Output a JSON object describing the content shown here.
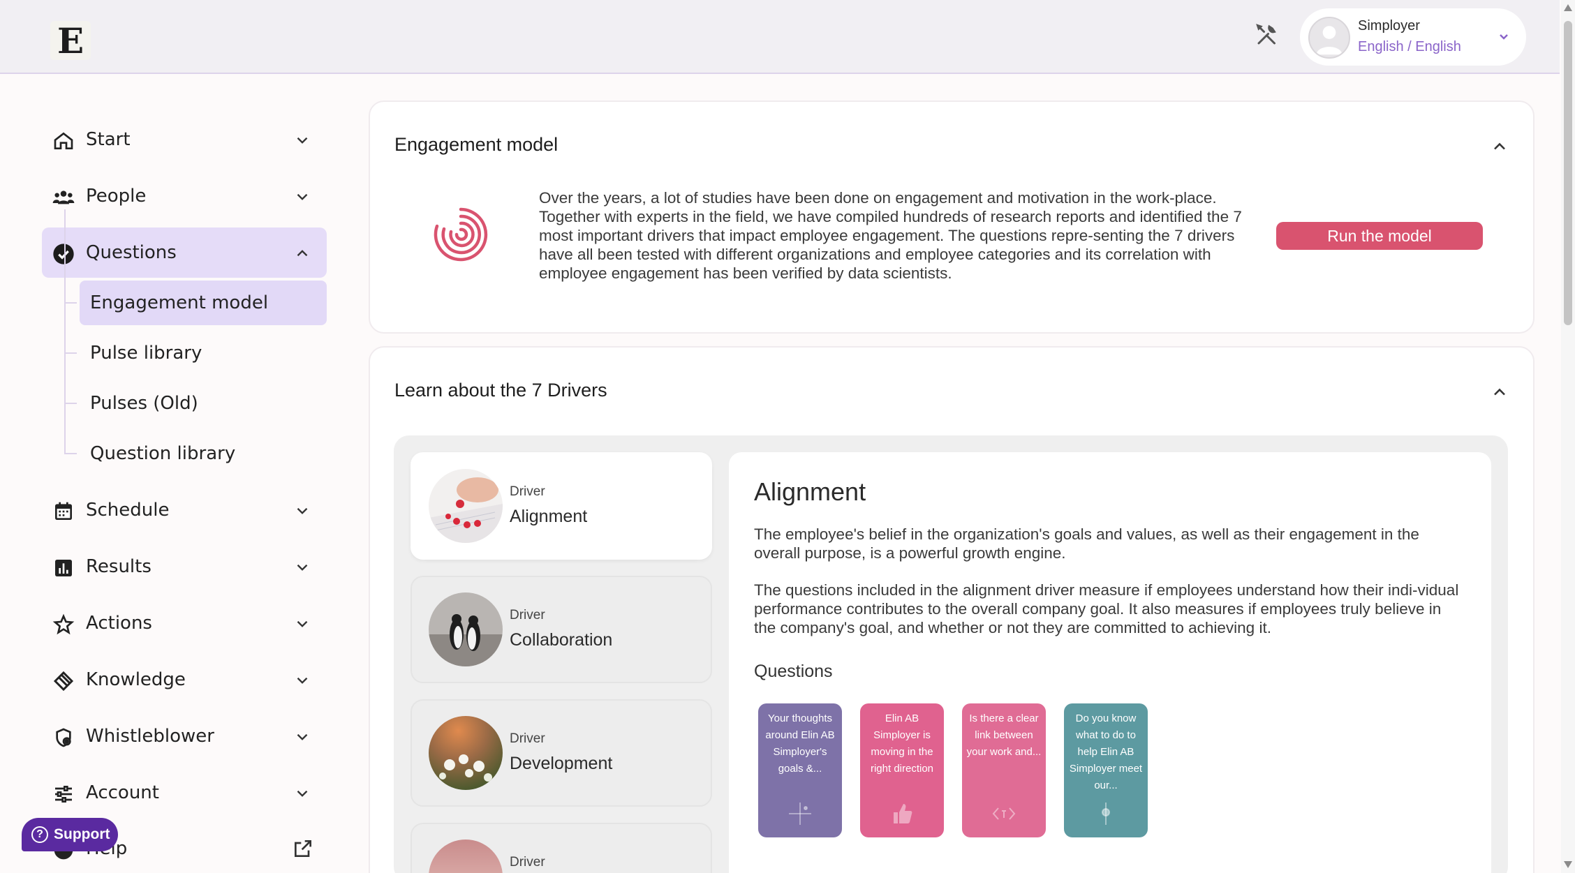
{
  "header": {
    "logo_letter": "E",
    "user_name": "Simployer",
    "user_language": "English / English"
  },
  "sidebar": {
    "items": [
      {
        "label": "Start",
        "icon": "home-icon"
      },
      {
        "label": "People",
        "icon": "people-icon"
      },
      {
        "label": "Questions",
        "icon": "check-circle-icon",
        "active": true
      },
      {
        "label": "Schedule",
        "icon": "calendar-icon"
      },
      {
        "label": "Results",
        "icon": "bar-chart-icon"
      },
      {
        "label": "Actions",
        "icon": "star-icon"
      },
      {
        "label": "Knowledge",
        "icon": "layers-icon"
      },
      {
        "label": "Whistleblower",
        "icon": "shield-icon"
      },
      {
        "label": "Account",
        "icon": "sliders-icon"
      },
      {
        "label": "Help",
        "icon": "help-icon"
      }
    ],
    "sub_items": [
      {
        "label": "Engagement model",
        "active": true
      },
      {
        "label": "Pulse library"
      },
      {
        "label": "Pulses (Old)"
      },
      {
        "label": "Question library"
      }
    ],
    "support_label": "Support"
  },
  "engagement": {
    "title": "Engagement model",
    "text": "Over the years, a lot of studies have been done on engagement and motivation in the work-place. Together with experts in the field, we have compiled hundreds of research reports and identified the 7 most important drivers that impact employee engagement. The questions repre-senting the 7 drivers have all been tested with different organizations and employee categories and its correlation with employee engagement has been verified by data scientists.",
    "button_label": "Run the model"
  },
  "drivers": {
    "title": "Learn about the 7 Drivers",
    "caption": "Driver",
    "list": [
      {
        "name": "Alignment",
        "active": true
      },
      {
        "name": "Collaboration"
      },
      {
        "name": "Development"
      },
      {
        "name": ""
      }
    ],
    "detail": {
      "title": "Alignment",
      "p1": "The employee's belief in the organization's goals and values, as well as their engagement in the overall purpose, is a powerful growth engine.",
      "p2": "The questions included in the alignment driver measure if employees understand how their indi-vidual performance contributes to the overall company goal. It also measures if employees truly believe in the company's goal, and whether or not they are committed to achieving it.",
      "questions_label": "Questions",
      "question_cards": [
        {
          "text": "Your thoughts around Elin AB Simployer's goals &...",
          "color": "#7e72a8"
        },
        {
          "text": "Elin AB Simployer is moving in the right direction",
          "color": "#e0628f"
        },
        {
          "text": "Is there a clear link between your work and...",
          "color": "#e06c95"
        },
        {
          "text": "Do you know what to do to help Elin AB Simployer meet our...",
          "color": "#5d9aa1"
        }
      ]
    }
  }
}
